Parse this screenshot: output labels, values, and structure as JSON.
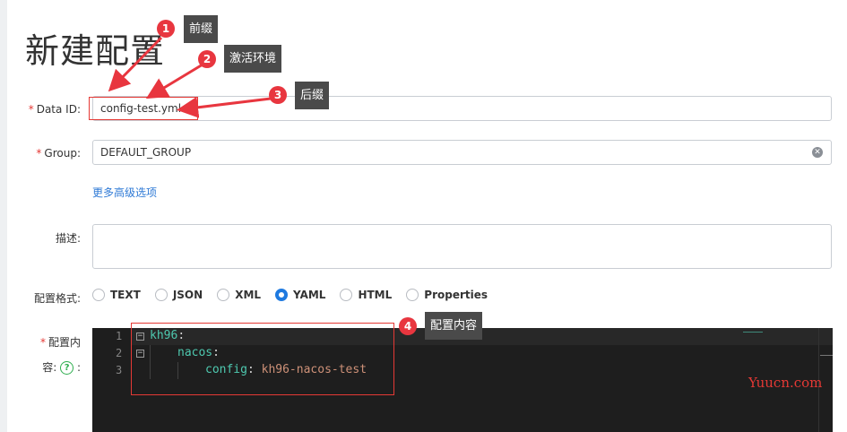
{
  "page": {
    "title": "新建配置"
  },
  "form": {
    "data_id": {
      "label": "Data ID:",
      "value": "config-test.yml"
    },
    "group": {
      "label": "Group:",
      "value": "DEFAULT_GROUP"
    },
    "advanced_link": "更多高级选项",
    "description": {
      "label": "描述:"
    },
    "format": {
      "label": "配置格式:",
      "options": [
        "TEXT",
        "JSON",
        "XML",
        "YAML",
        "HTML",
        "Properties"
      ],
      "selected": "YAML"
    },
    "content": {
      "label_line1": "配置内",
      "label_line2": "容:",
      "label_colon": ":"
    }
  },
  "editor": {
    "line_numbers": [
      "1",
      "2",
      "3"
    ],
    "lines": [
      {
        "key": "kh96",
        "sep": ":",
        "value": ""
      },
      {
        "key": "nacos",
        "sep": ":",
        "value": ""
      },
      {
        "key": "config",
        "sep": ": ",
        "value": "kh96-nacos-test"
      }
    ]
  },
  "annotations": [
    {
      "number": "1",
      "text": "前缀"
    },
    {
      "number": "2",
      "text": "激活环境"
    },
    {
      "number": "3",
      "text": "后缀"
    },
    {
      "number": "4",
      "text": "配置内容"
    }
  ],
  "watermark": "Yuucn.com",
  "colors": {
    "accent": "#1f7ae0",
    "required": "#e53935",
    "annotation": "#e8363f",
    "editor_bg": "#1e1e1e"
  }
}
